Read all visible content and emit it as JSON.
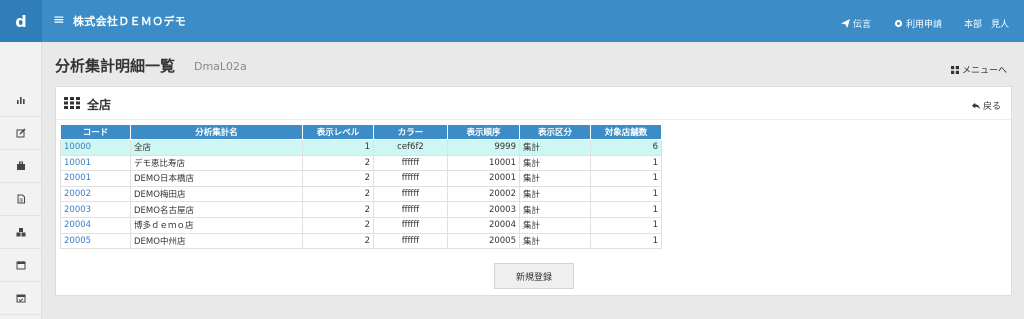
{
  "header": {
    "logo": "d",
    "company": "株式会社ＤＥＭＯデモ",
    "message_label": "伝言",
    "apply_label": "利用申請",
    "user_label": "本部　見人"
  },
  "page": {
    "title": "分析集計明細一覧",
    "subtitle": "DmaL02a",
    "menu_link": "メニューへ"
  },
  "panel": {
    "title": "全店",
    "back_label": "戻る",
    "new_button": "新規登録"
  },
  "table": {
    "headers": [
      "コード",
      "分析集計名",
      "表示レベル",
      "カラー",
      "表示順序",
      "表示区分",
      "対象店舗数"
    ],
    "rows": [
      [
        "10000",
        "全店",
        "1",
        "cef6f2",
        "9999",
        "集計",
        "6"
      ],
      [
        "10001",
        "デモ恵比寿店",
        "2",
        "ffffff",
        "10001",
        "集計",
        "1"
      ],
      [
        "20001",
        "DEMO日本橋店",
        "2",
        "ffffff",
        "20001",
        "集計",
        "1"
      ],
      [
        "20002",
        "DEMO梅田店",
        "2",
        "ffffff",
        "20002",
        "集計",
        "1"
      ],
      [
        "20003",
        "DEMO名古屋店",
        "2",
        "ffffff",
        "20003",
        "集計",
        "1"
      ],
      [
        "20004",
        "博多ｄｅｍｏ店",
        "2",
        "ffffff",
        "20004",
        "集計",
        "1"
      ],
      [
        "20005",
        "DEMO中州店",
        "2",
        "ffffff",
        "20005",
        "集計",
        "1"
      ]
    ]
  },
  "sidebar": {
    "icons": [
      "bar-chart-icon",
      "edit-icon",
      "briefcase-icon",
      "document-icon",
      "cubes-icon",
      "calendar-icon",
      "calendar-check-icon"
    ]
  },
  "colors": {
    "primary": "#3c8dc7",
    "highlight_row": "#cef6f2",
    "link": "#3b7fc4"
  }
}
